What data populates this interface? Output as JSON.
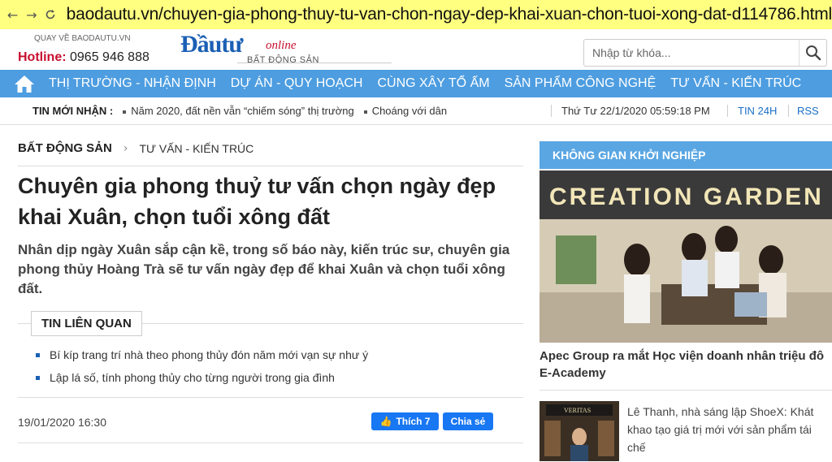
{
  "browser": {
    "url": "baodautu.vn/chuyen-gia-phong-thuy-tu-van-chon-ngay-dep-khai-xuan-chon-tuoi-xong-dat-d114786.html",
    "back_icon": "arrow-left-icon",
    "forward_icon": "arrow-right-icon",
    "reload_icon": "reload-icon"
  },
  "header": {
    "back_link": "QUAY VỀ BAODAUTU.VN",
    "hotline_label": "Hotline:",
    "hotline_number": "0965 946 888",
    "logo_main": "Đầutư",
    "logo_online": "online",
    "logo_sub": "BẤT ĐỘNG SẢN",
    "search_placeholder": "Nhập từ khóa..."
  },
  "nav": {
    "items": [
      "THỊ TRƯỜNG - NHẬN ĐỊNH",
      "DỰ ÁN - QUY HOẠCH",
      "CÙNG XÂY TỔ ẤM",
      "SẢN PHẨM CÔNG NGHỆ",
      "TƯ VẤN - KIẾN TRÚC"
    ]
  },
  "ticker": {
    "label": "TIN MỚI NHẬN :",
    "items": [
      "Năm 2020, đất nền vẫn “chiếm sóng” thị trường",
      "Choáng với dân"
    ],
    "datetime": "Thứ Tư 22/1/2020 05:59:18 PM",
    "tin24": "TIN 24H",
    "rss": "RSS"
  },
  "article": {
    "breadcrumb_main": "BẤT ĐỘNG SẢN",
    "breadcrumb_sub": "TƯ VẤN - KIẾN TRÚC",
    "title": "Chuyên gia phong thuỷ tư vấn chọn ngày đẹp khai Xuân, chọn tuổi xông đất",
    "sapo": "Nhân dịp ngày Xuân sắp cận kề, trong số báo này, kiến trúc sư, chuyên gia phong thủy Hoàng Trà sẽ tư vấn ngày đẹp để khai Xuân và chọn tuổi xông đất.",
    "related_title": "TIN LIÊN QUAN",
    "related": [
      "Bí kíp trang trí nhà theo phong thủy đón năm mới vạn sự như ý",
      "Lập lá số, tính phong thủy cho từng người trong gia đình"
    ],
    "date": "19/01/2020 16:30",
    "like_label": "Thích 7",
    "share_label": "Chia sẻ"
  },
  "sidebar": {
    "header": "KHÔNG GIAN KHỞI NGHIỆP",
    "image_sign": "CREATION GARDEN",
    "caption": "Apec Group ra mắt Học viện doanh nhân triệu đô E-Academy",
    "news_text": "Lê Thanh, nhà sáng lập ShoeX: Khát khao tạo giá trị mới với sản phẩm tái chế",
    "thumb_sign": "VERITAS"
  }
}
